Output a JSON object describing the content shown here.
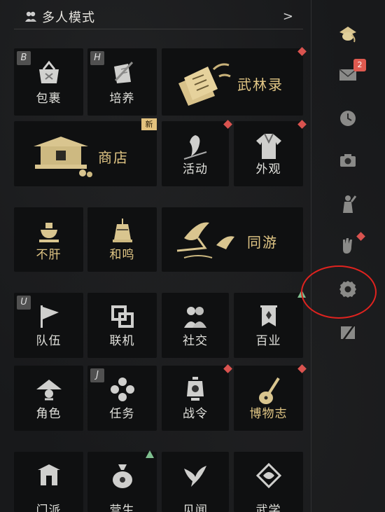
{
  "header": {
    "title": "多人模式",
    "chevron": ">"
  },
  "tiles": {
    "baoguo": {
      "label": "包裹",
      "key": "B"
    },
    "peiyang": {
      "label": "培养",
      "key": "H"
    },
    "wulinlu": {
      "label": "武林录"
    },
    "shangdian": {
      "label": "商店",
      "badge": "新"
    },
    "huodong": {
      "label": "活动"
    },
    "waiguan": {
      "label": "外观"
    },
    "bugan": {
      "label": "不肝"
    },
    "heming": {
      "label": "和鸣"
    },
    "tongyou": {
      "label": "同游"
    },
    "duiwu": {
      "label": "队伍",
      "key": "U"
    },
    "lianji": {
      "label": "联机"
    },
    "shejiao": {
      "label": "社交"
    },
    "baiye": {
      "label": "百业"
    },
    "juese": {
      "label": "角色"
    },
    "renwu": {
      "label": "任务",
      "key": "J"
    },
    "zhanling": {
      "label": "战令"
    },
    "bowuzhi": {
      "label": "博物志"
    },
    "row6a": {
      "label": "门派"
    },
    "row6b": {
      "label": "营生"
    },
    "row6c": {
      "label": "见闻"
    },
    "row6d": {
      "label": "武学"
    }
  },
  "sidebar": {
    "mail_count": "2"
  },
  "colors": {
    "gold": "#e2c785",
    "red_dot": "#d9534f",
    "green_tri": "#7fbf8f",
    "circle": "#e0231f"
  }
}
